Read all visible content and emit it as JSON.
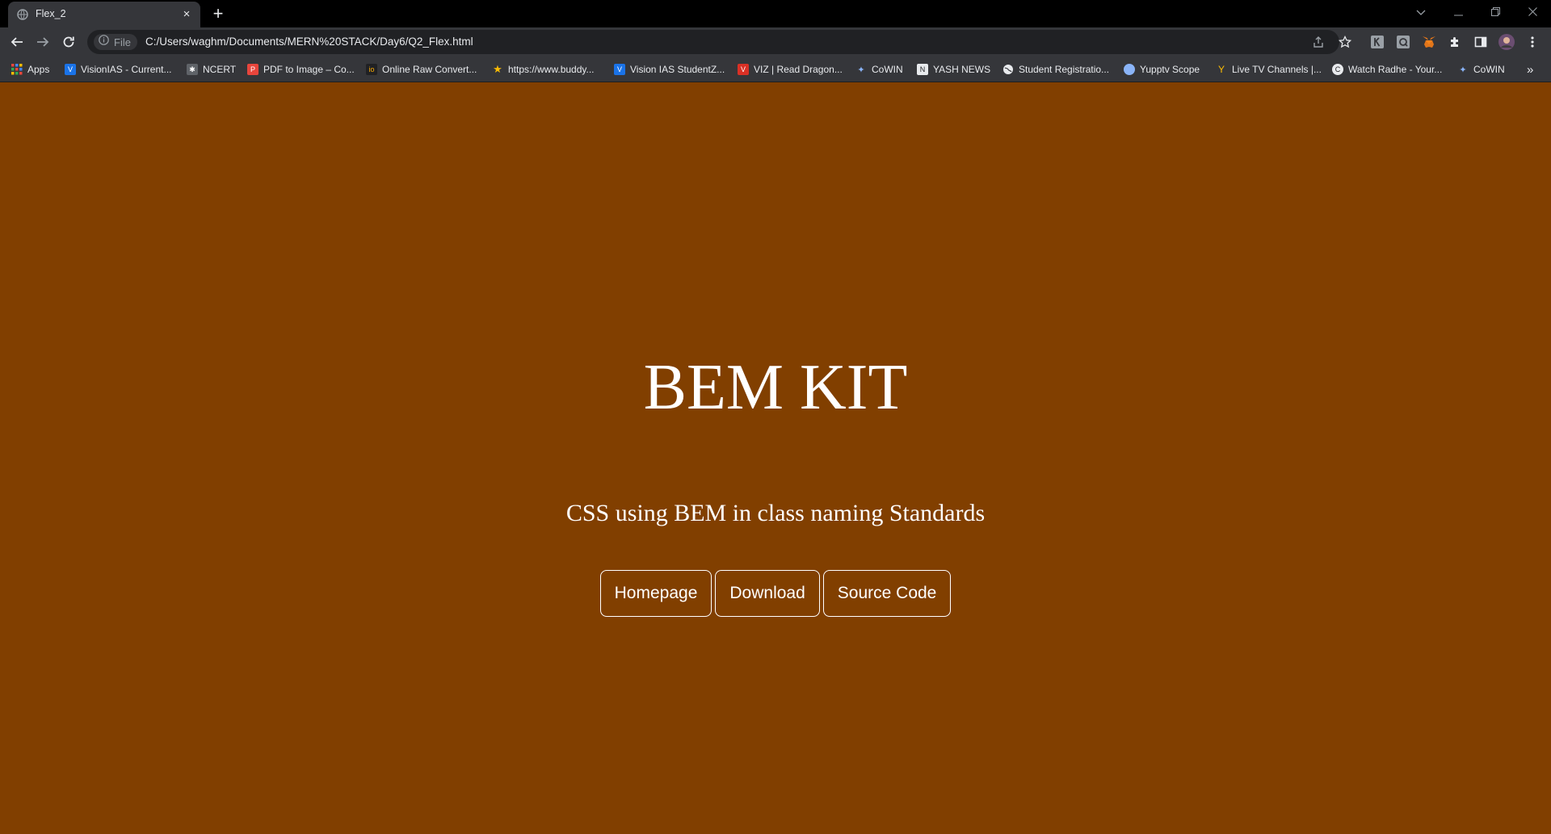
{
  "browser": {
    "tab_title": "Flex_2",
    "tab_close_glyph": "×",
    "new_tab_glyph": "+",
    "url_scheme_label": "File",
    "url": "C:/Users/waghm/Documents/MERN%20STACK/Day6/Q2_Flex.html",
    "bookmarks": [
      {
        "label": "Apps",
        "icon": "apps-grid-icon",
        "color": "#e8453c"
      },
      {
        "label": "VisionIAS - Current...",
        "icon": "visionias-icon",
        "color": "#8ab4f8"
      },
      {
        "label": "NCERT",
        "icon": "ncert-icon",
        "color": "#9aa0a6"
      },
      {
        "label": "PDF to Image – Co...",
        "icon": "pdf-icon",
        "color": "#e8453c"
      },
      {
        "label": "Online Raw Convert...",
        "icon": "raw-convert-icon",
        "color": "#f9ab00"
      },
      {
        "label": "https://www.buddy...",
        "icon": "star-icon",
        "color": "#fbbc04"
      },
      {
        "label": "Vision IAS StudentZ...",
        "icon": "visionias-icon",
        "color": "#8ab4f8"
      },
      {
        "label": "VIZ | Read Dragon...",
        "icon": "viz-icon",
        "color": "#d93025"
      },
      {
        "label": "CoWIN",
        "icon": "cowin-icon",
        "color": "#8ab4f8"
      },
      {
        "label": "YASH NEWS",
        "icon": "news-icon",
        "color": "#e8eaed"
      },
      {
        "label": "Student Registratio...",
        "icon": "globe-icon",
        "color": "#e8eaed"
      },
      {
        "label": "Yupptv Scope",
        "icon": "yupptv-icon",
        "color": "#8ab4f8"
      },
      {
        "label": "Live TV Channels |...",
        "icon": "livetv-icon",
        "color": "#fbbc04"
      },
      {
        "label": "Watch Radhe - Your...",
        "icon": "watch-icon",
        "color": "#e8eaed"
      },
      {
        "label": "CoWIN",
        "icon": "cowin-icon",
        "color": "#8ab4f8"
      }
    ],
    "overflow_glyph": "»"
  },
  "page": {
    "background": "#813f00",
    "title": "BEM KIT",
    "subtitle": "CSS using BEM in class naming Standards",
    "buttons": [
      {
        "label": "Homepage"
      },
      {
        "label": "Download"
      },
      {
        "label": "Source Code"
      }
    ]
  }
}
